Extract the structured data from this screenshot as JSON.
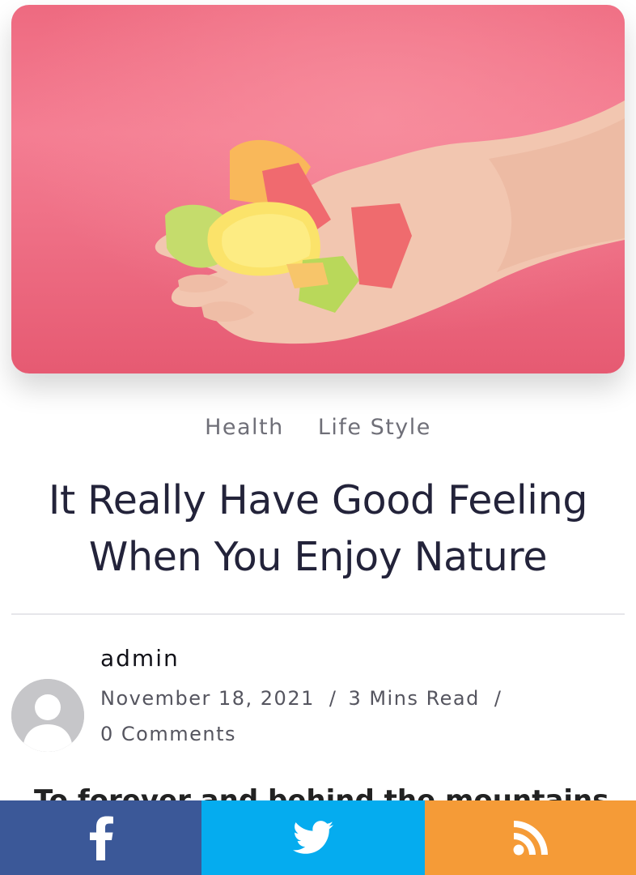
{
  "post": {
    "hero_image": {
      "alt": "hand holding colorful jelly candies on pink background"
    },
    "categories": [
      "Health",
      "Life Style"
    ],
    "title": "It Really Have Good Feeling When You Enjoy Nature",
    "author": "admin",
    "date": "November 18, 2021",
    "separator": "/",
    "read_time": "3 Mins Read",
    "comments": "0 Comments",
    "excerpt_partial": "To forever and behind the mountains"
  },
  "share": {
    "buttons": [
      {
        "network": "facebook",
        "icon": "facebook-icon",
        "color": "#3b5898"
      },
      {
        "network": "twitter",
        "icon": "twitter-icon",
        "color": "#05acef"
      },
      {
        "network": "rss",
        "icon": "rss-icon",
        "color": "#f59b37"
      }
    ]
  },
  "colors": {
    "title": "#23233a",
    "category": "#6f6f78",
    "hero_background": "#f0697f"
  }
}
